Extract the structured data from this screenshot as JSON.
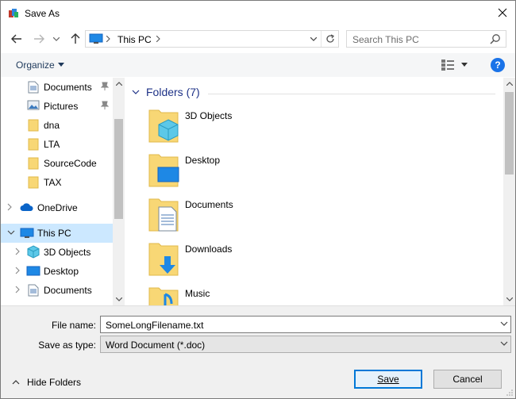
{
  "window": {
    "title": "Save As"
  },
  "nav": {
    "address_location": "This PC",
    "search_placeholder": "Search This PC"
  },
  "toolbar": {
    "organize_label": "Organize"
  },
  "sidebar": {
    "items": [
      {
        "label": "Documents",
        "icon": "documents-icon",
        "pinned": true
      },
      {
        "label": "Pictures",
        "icon": "pictures-icon",
        "pinned": true
      },
      {
        "label": "dna",
        "icon": "folder-icon"
      },
      {
        "label": "LTA",
        "icon": "folder-icon"
      },
      {
        "label": "SourceCode",
        "icon": "folder-icon"
      },
      {
        "label": "TAX",
        "icon": "folder-icon"
      },
      {
        "label": "OneDrive",
        "icon": "onedrive-icon"
      },
      {
        "label": "This PC",
        "icon": "this-pc-icon",
        "selected": true
      },
      {
        "label": "3D Objects",
        "icon": "3d-objects-icon"
      },
      {
        "label": "Desktop",
        "icon": "desktop-icon"
      },
      {
        "label": "Documents",
        "icon": "documents-icon"
      }
    ]
  },
  "main": {
    "group_header": "Folders (7)",
    "folders": [
      {
        "label": "3D Objects",
        "icon": "3d-objects-folder-icon"
      },
      {
        "label": "Desktop",
        "icon": "desktop-folder-icon"
      },
      {
        "label": "Documents",
        "icon": "documents-folder-icon"
      },
      {
        "label": "Downloads",
        "icon": "downloads-folder-icon"
      },
      {
        "label": "Music",
        "icon": "music-folder-icon"
      }
    ]
  },
  "form": {
    "filename_label": "File name:",
    "filename_value": "SomeLongFilename.txt",
    "savetype_label": "Save as type:",
    "savetype_value": "Word Document (*.doc)"
  },
  "footer": {
    "hide_folders_label": "Hide Folders",
    "save_label": "Save",
    "cancel_label": "Cancel"
  },
  "colors": {
    "accent": "#0078d7",
    "selection": "#cce8ff",
    "header_blue": "#1e3287"
  }
}
